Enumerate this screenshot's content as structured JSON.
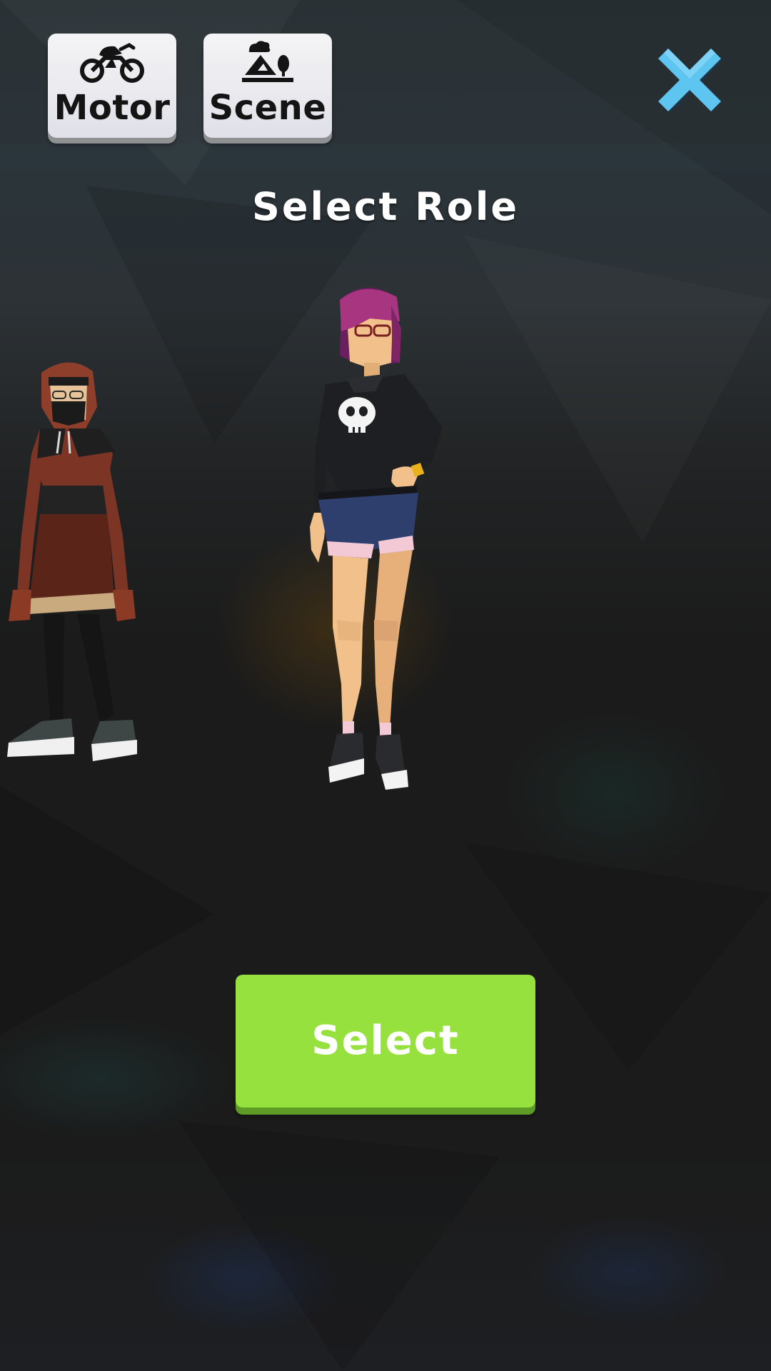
{
  "top_buttons": {
    "motor": {
      "label": "Motor",
      "icon": "motorcycle-icon"
    },
    "scene": {
      "label": "Scene",
      "icon": "landscape-icon"
    }
  },
  "close_icon": "close-icon",
  "title": "Select Role",
  "characters": [
    {
      "name": "hooded-masked-character",
      "position": "left",
      "selected": false
    },
    {
      "name": "purple-haired-skull-hoodie-character",
      "position": "center",
      "selected": true
    }
  ],
  "select_button": {
    "label": "Select"
  },
  "colors": {
    "select_button": "#97e13f",
    "close_icon": "#5ec4f0",
    "title_text": "#ffffff",
    "top_button_bg": "#eaeaef"
  }
}
